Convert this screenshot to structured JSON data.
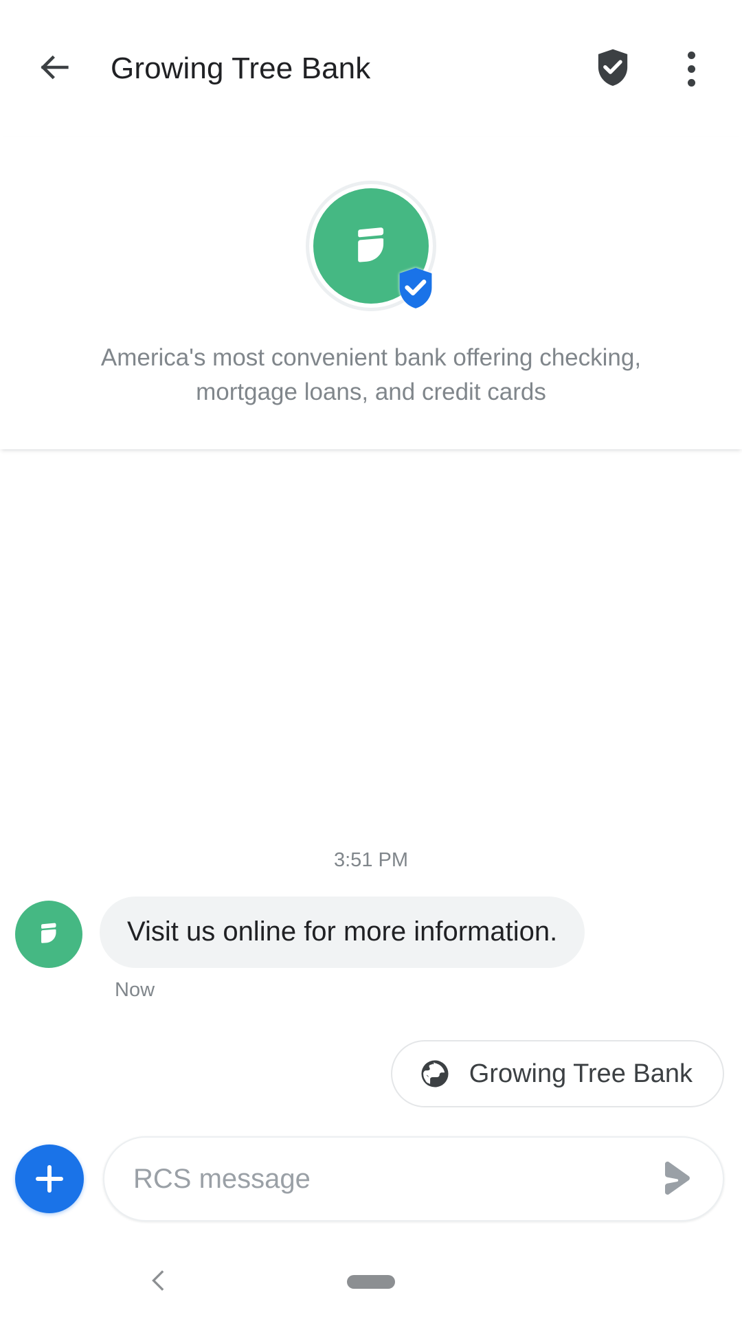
{
  "appbar": {
    "back_icon": "arrow-left-icon",
    "title": "Growing Tree Bank",
    "verified_icon": "verified-shield-icon",
    "overflow_icon": "more-vert-icon",
    "title_color": "#202124",
    "icon_color": "#3c4043"
  },
  "profile": {
    "avatar_icon": "leaf-logo-icon",
    "avatar_color": "#45b883",
    "verified_badge_icon": "verified-shield-badge-icon",
    "verified_badge_color": "#1a73e8",
    "description": "America's most convenient bank offering checking, mortgage loans, and credit cards",
    "description_color": "#80868b"
  },
  "conversation": {
    "timestamp": "3:51 PM",
    "messages": [
      {
        "sender_avatar_icon": "leaf-logo-icon",
        "text": "Visit us online for more information.",
        "status": "Now",
        "bubble_color": "#f1f3f4",
        "text_color": "#202124"
      }
    ]
  },
  "suggestions": {
    "chips": [
      {
        "icon": "globe-icon",
        "label": "Growing Tree Bank"
      }
    ]
  },
  "composer": {
    "attach_icon": "plus-icon",
    "attach_color": "#1a73e8",
    "input_value": "",
    "placeholder": "RCS message",
    "send_icon": "send-arrow-icon",
    "send_color": "#9aa0a6"
  },
  "navbar": {
    "back_icon": "chevron-left-icon",
    "home_icon": "home-pill-handle-icon",
    "icon_color": "#8c8f92"
  }
}
